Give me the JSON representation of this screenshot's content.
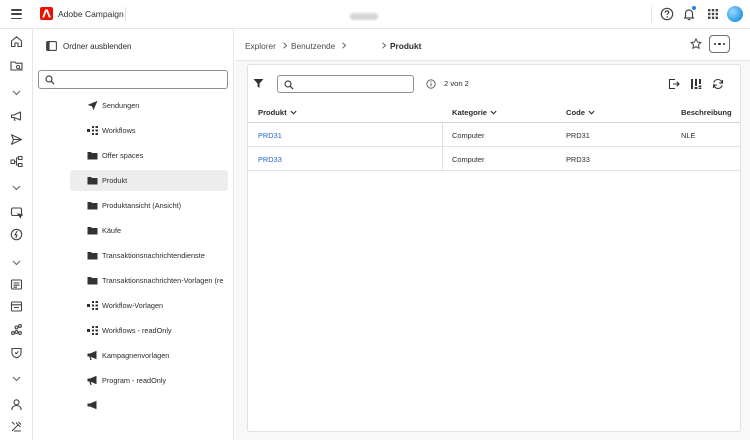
{
  "topbar": {
    "app_title": "Adobe Campaign"
  },
  "folder_panel": {
    "hide_label": "Ordner ausblenden",
    "search_placeholder": "",
    "items": [
      {
        "label": "Sendungen",
        "icon": "send-icon"
      },
      {
        "label": "Workflows",
        "icon": "workflow-icon"
      },
      {
        "label": "Offer spaces",
        "icon": "folder-icon"
      },
      {
        "label": "Produkt",
        "icon": "folder-icon",
        "selected": true
      },
      {
        "label": "Produktansicht (Ansicht)",
        "icon": "folder-icon"
      },
      {
        "label": "Käufe",
        "icon": "folder-icon"
      },
      {
        "label": "Transaktionsnachrichtendienste",
        "icon": "folder-icon"
      },
      {
        "label": "Transaktionsnachrichten-Vorlagen (re",
        "icon": "folder-icon"
      },
      {
        "label": "Workflow-Vorlagen",
        "icon": "workflow-icon"
      },
      {
        "label": "Workflows - readOnly",
        "icon": "workflow-icon"
      },
      {
        "label": "Kampagnenvorlagen",
        "icon": "megaphone-icon"
      },
      {
        "label": "Program - readOnly",
        "icon": "megaphone-icon"
      }
    ]
  },
  "breadcrumb": {
    "explorer": "Explorer",
    "benutzende": "Benutzende",
    "current": "Produkt"
  },
  "list": {
    "search_placeholder": "",
    "count": "2 von 2",
    "columns": {
      "produkt": "Produkt",
      "kategorie": "Kategorie",
      "code": "Code",
      "beschreibung": "Beschreibung"
    },
    "rows": [
      {
        "produkt": "PRD31",
        "kategorie": "Computer",
        "code": "PRD31",
        "beschreibung": "NLE"
      },
      {
        "produkt": "PRD33",
        "kategorie": "Computer",
        "code": "PRD33",
        "beschreibung": ""
      }
    ]
  },
  "colors": {
    "brand": "#eb1000",
    "link": "#2565c2",
    "notification": "#2680eb"
  }
}
